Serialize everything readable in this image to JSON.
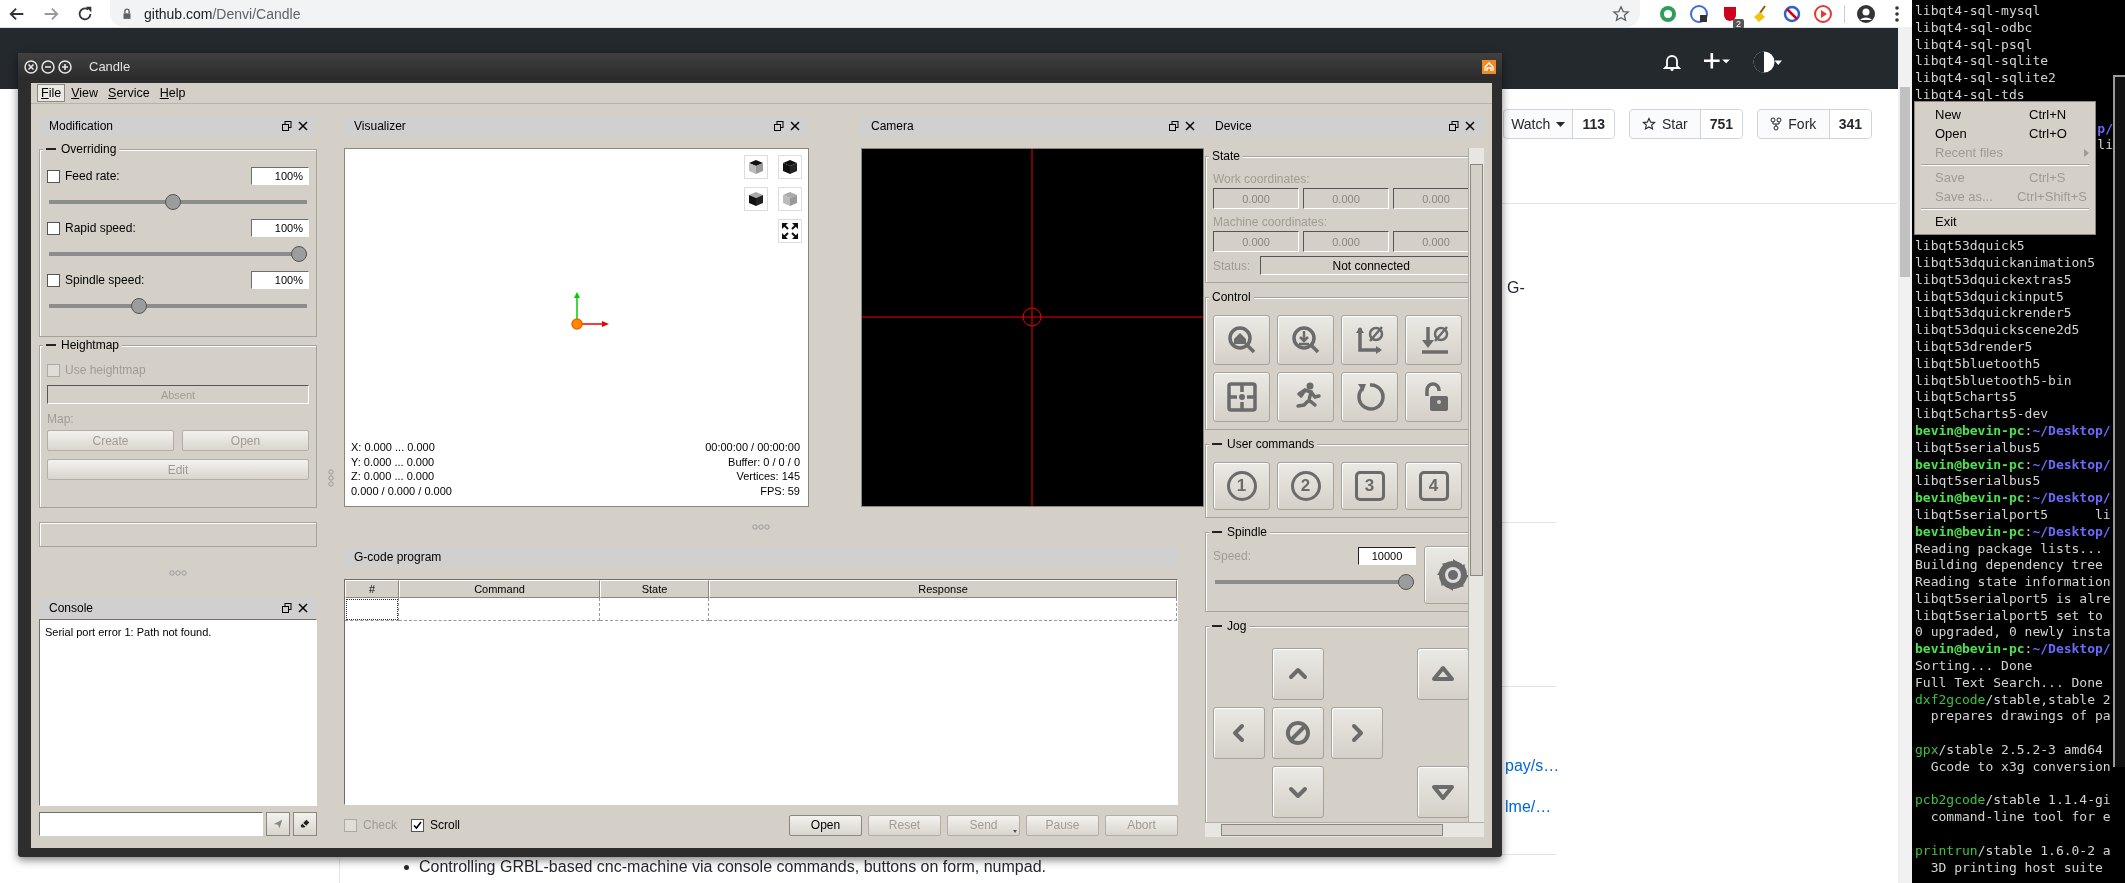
{
  "browser": {
    "url_host": "github.com",
    "url_path": "/Denvi/Candle",
    "extension_badge": "2"
  },
  "github": {
    "repo_buttons": [
      {
        "label": "Watch",
        "count": "113",
        "has_menu": true
      },
      {
        "label": "Star",
        "count": "751",
        "has_menu": false
      },
      {
        "label": "Fork",
        "count": "341",
        "has_menu": false
      }
    ],
    "readme_fragment": "G-",
    "links": [
      "pay/s…",
      "lme/…"
    ],
    "bullet": "Controlling GRBL-based cnc-machine via console commands, buttons on form, numpad."
  },
  "candle": {
    "title": "Candle",
    "menu": [
      {
        "label": "File",
        "selected": true
      },
      {
        "label": "View",
        "selected": false
      },
      {
        "label": "Service",
        "selected": false
      },
      {
        "label": "Help",
        "selected": false
      }
    ],
    "modification": {
      "title": "Modification",
      "overriding": {
        "title": "Overriding",
        "collapsible": true,
        "rows": [
          {
            "label": "Feed rate:",
            "checked": false,
            "value": "100%",
            "level": 0.48
          },
          {
            "label": "Rapid speed:",
            "checked": false,
            "value": "100%",
            "level": 1
          },
          {
            "label": "Spindle speed:",
            "checked": false,
            "value": "100%",
            "level": 0.34
          }
        ]
      },
      "heightmap": {
        "title": "Heightmap",
        "collapsible": true,
        "use": {
          "label": "Use heightmap",
          "checked": false,
          "disabled": true
        },
        "field": "Absent",
        "map_label": "Map:",
        "buttons": [
          {
            "label": "Create",
            "disabled": true
          },
          {
            "label": "Open",
            "disabled": true
          },
          {
            "label": "Edit",
            "disabled": true
          }
        ]
      }
    },
    "console": {
      "title": "Console",
      "text": "Serial port error 1: Path not found."
    },
    "visualizer": {
      "title": "Visualizer",
      "info_left": [
        "X: 0.000 ... 0.000",
        "Y: 0.000 ... 0.000",
        "Z: 0.000 ... 0.000",
        "0.000 / 0.000 / 0.000"
      ],
      "info_right": [
        "00:00:00 / 00:00:00",
        "Buffer: 0 / 0 / 0",
        "Vertices: 145",
        "FPS: 59"
      ]
    },
    "camera": {
      "title": "Camera"
    },
    "gcode": {
      "title": "G-code program",
      "columns": [
        "#",
        "Command",
        "State",
        "Response"
      ],
      "options": [
        {
          "label": "Check",
          "checked": false,
          "disabled": true
        },
        {
          "label": "Scroll",
          "checked": true,
          "disabled": false
        }
      ],
      "buttons": [
        {
          "label": "Open",
          "disabled": false,
          "has_menu": false
        },
        {
          "label": "Reset",
          "disabled": true,
          "has_menu": false
        },
        {
          "label": "Send",
          "disabled": true,
          "has_menu": true
        },
        {
          "label": "Pause",
          "disabled": true,
          "has_menu": false
        },
        {
          "label": "Abort",
          "disabled": true,
          "has_menu": false
        }
      ]
    },
    "device": {
      "title": "Device",
      "state": {
        "title": "State",
        "collapsible": false,
        "work_label": "Work coordinates:",
        "work": [
          "0.000",
          "0.000",
          "0.000"
        ],
        "machine_label": "Machine coordinates:",
        "machine": [
          "0.000",
          "0.000",
          "0.000"
        ],
        "status_label": "Status:",
        "status": "Not connected"
      },
      "control": {
        "title": "Control",
        "collapsible": false
      },
      "user_commands": {
        "title": "User commands",
        "collapsible": true,
        "buttons": [
          {
            "label": "1",
            "kind": "circle"
          },
          {
            "label": "2",
            "kind": "circle"
          },
          {
            "label": "3",
            "kind": "square"
          },
          {
            "label": "4",
            "kind": "square"
          }
        ]
      },
      "spindle": {
        "title": "Spindle",
        "collapsible": true,
        "speed_label": "Speed:",
        "speed": "10000",
        "level": 1
      },
      "jog": {
        "title": "Jog",
        "collapsible": true
      }
    }
  },
  "terminal": {
    "lines": [
      {
        "kind": "plain",
        "text": "libqt4-sql-mysql"
      },
      {
        "kind": "plain",
        "text": "libqt4-sql-odbc"
      },
      {
        "kind": "plain",
        "text": "libqt4-sql-psql"
      },
      {
        "kind": "plain",
        "text": "libqt4-sql-sqlite"
      },
      {
        "kind": "plain",
        "text": "libqt4-sql-sqlite2"
      },
      {
        "kind": "plain",
        "text": "libqt4-sql-tds"
      },
      {
        "kind": "gap"
      },
      {
        "kind": "tail_path",
        "text": "p/"
      },
      {
        "kind": "tail",
        "text": "li"
      },
      {
        "kind": "gap"
      },
      {
        "kind": "gap"
      },
      {
        "kind": "gap"
      },
      {
        "kind": "gap"
      },
      {
        "kind": "gap"
      },
      {
        "kind": "plain",
        "text": "libqt53dquick5"
      },
      {
        "kind": "plain",
        "text": "libqt53dquickanimation5"
      },
      {
        "kind": "plain",
        "text": "libqt53dquickextras5"
      },
      {
        "kind": "plain",
        "text": "libqt53dquickinput5"
      },
      {
        "kind": "plain",
        "text": "libqt53dquickrender5"
      },
      {
        "kind": "plain",
        "text": "libqt53dquickscene2d5"
      },
      {
        "kind": "plain",
        "text": "libqt53drender5"
      },
      {
        "kind": "plain",
        "text": "libqt5bluetooth5"
      },
      {
        "kind": "plain",
        "text": "libqt5bluetooth5-bin"
      },
      {
        "kind": "plain",
        "text": "libqt5charts5"
      },
      {
        "kind": "plain",
        "text": "libqt5charts5-dev"
      },
      {
        "kind": "prompt",
        "user": "bevin@bevin-pc",
        "sep": ":",
        "path": "~/Desktop/"
      },
      {
        "kind": "plain",
        "text": "libqt5serialbus5"
      },
      {
        "kind": "prompt",
        "user": "bevin@bevin-pc",
        "sep": ":",
        "path": "~/Desktop/"
      },
      {
        "kind": "plain",
        "text": "libqt5serialbus5"
      },
      {
        "kind": "prompt",
        "user": "bevin@bevin-pc",
        "sep": ":",
        "path": "~/Desktop/"
      },
      {
        "kind": "plain",
        "text": "libqt5serialport5      li"
      },
      {
        "kind": "prompt",
        "user": "bevin@bevin-pc",
        "sep": ":",
        "path": "~/Desktop/"
      },
      {
        "kind": "plain",
        "text": "Reading package lists..."
      },
      {
        "kind": "plain",
        "text": "Building dependency tree"
      },
      {
        "kind": "plain",
        "text": "Reading state information"
      },
      {
        "kind": "plain",
        "text": "libqt5serialport5 is alre"
      },
      {
        "kind": "plain",
        "text": "libqt5serialport5 set to"
      },
      {
        "kind": "plain",
        "text": "0 upgraded, 0 newly insta"
      },
      {
        "kind": "prompt",
        "user": "bevin@bevin-pc",
        "sep": ":",
        "path": "~/Desktop/"
      },
      {
        "kind": "plain",
        "text": "Sorting... Done"
      },
      {
        "kind": "plain",
        "text": "Full Text Search... Done"
      },
      {
        "kind": "package",
        "name": "dxf2gcode",
        "rest": "/stable,stable 2"
      },
      {
        "kind": "plain",
        "text": "  prepares drawings of pa"
      },
      {
        "kind": "gap"
      },
      {
        "kind": "package",
        "name": "gpx",
        "rest": "/stable 2.5.2-3 amd64"
      },
      {
        "kind": "plain",
        "text": "  Gcode to x3g conversion"
      },
      {
        "kind": "gap"
      },
      {
        "kind": "package",
        "name": "pcb2gcode",
        "rest": "/stable 1.1.4-gi"
      },
      {
        "kind": "plain",
        "text": "  command-line tool for e"
      },
      {
        "kind": "gap"
      },
      {
        "kind": "package",
        "name": "printrun",
        "rest": "/stable 1.6.0-2 a"
      },
      {
        "kind": "plain",
        "text": "  3D printing host suite"
      }
    ]
  },
  "context_menu": {
    "items": [
      {
        "kind": "item",
        "label": "New",
        "shortcut": "Ctrl+N",
        "disabled": false
      },
      {
        "kind": "item",
        "label": "Open",
        "shortcut": "Ctrl+O",
        "disabled": false
      },
      {
        "kind": "submenu",
        "label": "Recent files",
        "disabled": true
      },
      {
        "kind": "separator"
      },
      {
        "kind": "item",
        "label": "Save",
        "shortcut": "Ctrl+S",
        "disabled": true
      },
      {
        "kind": "item",
        "label": "Save as...",
        "shortcut": "Ctrl+Shift+S",
        "disabled": true
      },
      {
        "kind": "separator"
      },
      {
        "kind": "item",
        "label": "Exit",
        "disabled": false
      }
    ]
  }
}
